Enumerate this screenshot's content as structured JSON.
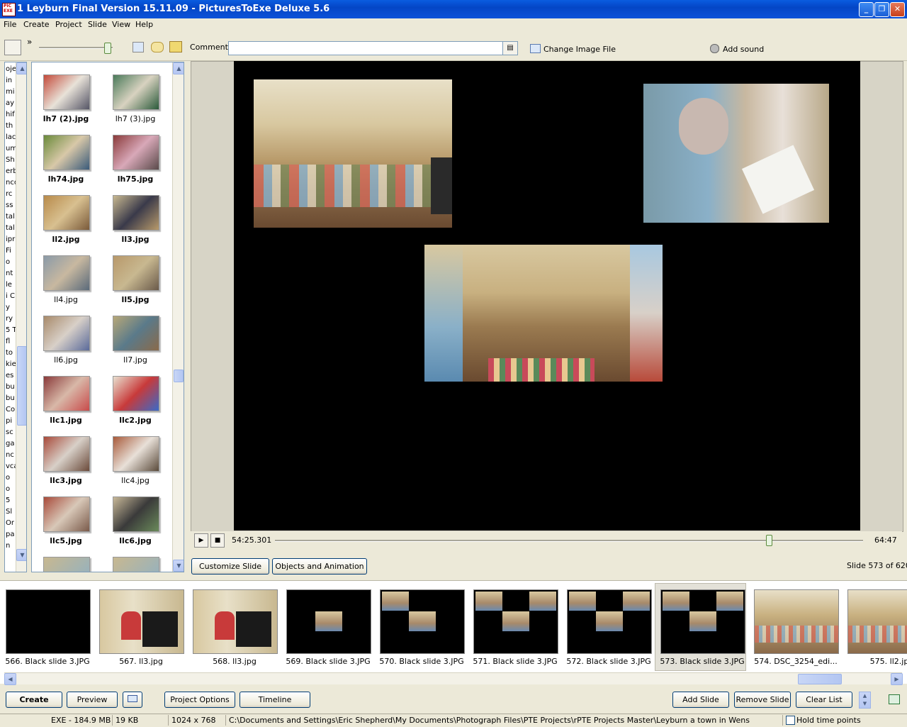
{
  "window": {
    "title": "1 Leyburn Final Version 15.11.09 - PicturesToExe Deluxe 5.6",
    "app_icon_text": "PIC EXE"
  },
  "menu": [
    "File",
    "Create",
    "Project",
    "Slide",
    "View",
    "Help"
  ],
  "toolbar": {
    "comment_label": "Comment",
    "comment_value": "",
    "change_image_label": "Change Image File",
    "add_sound_label": "Add sound",
    "chevron": "»"
  },
  "folder_tree_fragments": [
    "oje",
    "in",
    "mi",
    "ay",
    "hif",
    "th",
    "lac",
    "um",
    "Sh",
    "erb",
    "nco",
    "rc",
    "ss",
    "tal",
    "tal",
    "ipr",
    "Fi",
    "o",
    "nt",
    "le",
    "i C",
    "y",
    "ry",
    "5 T",
    "fl",
    "to",
    "kie",
    "es",
    "bu",
    "bu",
    "Co",
    "pi",
    "sc",
    "ga",
    "nc",
    "vca",
    "o",
    "o",
    "5",
    "Sl",
    "Or",
    "pa",
    "n"
  ],
  "thumbnails": [
    {
      "label": "lh7 (2).jpg",
      "bold": true,
      "colors": [
        "#c44a3a",
        "#e8e2d8",
        "#556"
      ]
    },
    {
      "label": "lh7 (3).jpg",
      "bold": false,
      "colors": [
        "#4a7a5a",
        "#d8d2c0",
        "#2a5a3a"
      ]
    },
    {
      "label": "lh74.jpg",
      "bold": true,
      "colors": [
        "#6a8a3a",
        "#d8c8a8",
        "#3a5a7a"
      ]
    },
    {
      "label": "lh75.jpg",
      "bold": true,
      "colors": [
        "#8a3a3a",
        "#d8a8b8",
        "#5a4a4a"
      ]
    },
    {
      "label": "ll2.jpg",
      "bold": true,
      "colors": [
        "#b88a4a",
        "#d8c090",
        "#7a5a3a"
      ]
    },
    {
      "label": "ll3.jpg",
      "bold": true,
      "colors": [
        "#c8b890",
        "#3a3a4a",
        "#b89a6a"
      ]
    },
    {
      "label": "ll4.jpg",
      "bold": false,
      "colors": [
        "#8a9aa8",
        "#c8b8a0",
        "#5a6a7a"
      ]
    },
    {
      "label": "ll5.jpg",
      "bold": true,
      "colors": [
        "#b8986a",
        "#c8b890",
        "#6a5a4a"
      ]
    },
    {
      "label": "ll6.jpg",
      "bold": false,
      "colors": [
        "#a88a6a",
        "#d8d0c8",
        "#5a6a9a"
      ]
    },
    {
      "label": "ll7.jpg",
      "bold": false,
      "colors": [
        "#b8a878",
        "#5a7a8a",
        "#8a6a4a"
      ]
    },
    {
      "label": "llc1.jpg",
      "bold": true,
      "colors": [
        "#8a3a3a",
        "#d8b8a8",
        "#c84a4a"
      ]
    },
    {
      "label": "llc2.jpg",
      "bold": true,
      "colors": [
        "#e8e0d0",
        "#c83a3a",
        "#3a6ac8"
      ]
    },
    {
      "label": "llc3.jpg",
      "bold": true,
      "colors": [
        "#a84a3a",
        "#d8d0c8",
        "#6a4a3a"
      ]
    },
    {
      "label": "llc4.jpg",
      "bold": false,
      "colors": [
        "#a85a3a",
        "#e8e0d8",
        "#5a4a3a"
      ]
    },
    {
      "label": "llc5.jpg",
      "bold": true,
      "colors": [
        "#a84a3a",
        "#d8c8b8",
        "#7a5a4a"
      ]
    },
    {
      "label": "llc6.jpg",
      "bold": true,
      "colors": [
        "#c8b898",
        "#3a3a3a",
        "#6a8a5a"
      ]
    }
  ],
  "transport": {
    "play_icon": "▶",
    "stop_icon": "■",
    "current_time": "54:25.301",
    "total_time": "64:47",
    "position_fraction": 0.84
  },
  "buttons": {
    "customize_slide": "Customize Slide",
    "objects_animation": "Objects and Animation",
    "create": "Create",
    "preview": "Preview",
    "project_options": "Project Options",
    "timeline": "Timeline",
    "add_slide": "Add Slide",
    "remove_slide": "Remove Slide",
    "clear_list": "Clear List"
  },
  "slide_counter": "Slide 573 of 620",
  "slides": [
    {
      "label": "566. Black slide 3.JPG",
      "kind": "black"
    },
    {
      "label": "567. ll3.jpg",
      "kind": "piano"
    },
    {
      "label": "568. ll3.jpg",
      "kind": "piano"
    },
    {
      "label": "569. Black slide 3.JPG",
      "kind": "one"
    },
    {
      "label": "570. Black slide 3.JPG",
      "kind": "two"
    },
    {
      "label": "571. Black slide 3.JPG",
      "kind": "three"
    },
    {
      "label": "572. Black slide 3.JPG",
      "kind": "three"
    },
    {
      "label": "573. Black slide 3.JPG",
      "kind": "three",
      "selected": true
    },
    {
      "label": "574. DSC_3254_edi...",
      "kind": "hall"
    },
    {
      "label": "575. ll2.jp",
      "kind": "hall"
    }
  ],
  "status": {
    "exe": "EXE - 184.9 MB",
    "size": "19 KB",
    "resolution": "1024 x 768",
    "path": "C:\\Documents and Settings\\Eric  Shepherd\\My Documents\\Photograph Files\\PTE Projects\\rPTE Projects Master\\Leyburn a town in Wens",
    "hold_time_points": "Hold time points"
  }
}
